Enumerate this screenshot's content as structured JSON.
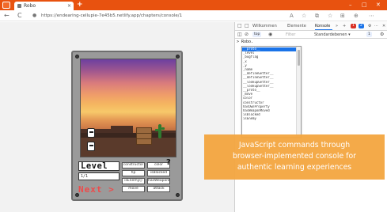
{
  "browser": {
    "tab_title": "Robo",
    "tab_close": "×",
    "new_tab": "+",
    "url": "https://endearing-cellupie-7e45b5.netlify.app/chapters/console/1",
    "window_controls": {
      "minimize": "–",
      "maximize": "□",
      "close": "✕"
    },
    "nav": {
      "back": "←",
      "reload": "C",
      "lock": "🔒"
    },
    "toolbar_icons": [
      "A",
      "☆",
      "⧉",
      "☆",
      "⊞",
      "⊕",
      "⋯"
    ],
    "accent_color": "#e8520f"
  },
  "game": {
    "level_label": "Level",
    "input_value": "1/1",
    "next_label": "Next >",
    "help_label": "?",
    "buttons": [
      "constructor",
      "color",
      "hp",
      "isBlocked",
      "isEnemy()",
      "hasWeaponMoved",
      "move",
      "attack"
    ]
  },
  "devtools": {
    "tabs": [
      "Willkommen",
      "Elemente",
      "Konsole",
      "»",
      "+"
    ],
    "active_tab": "Konsole",
    "error_count": "1",
    "warning_count": "2",
    "more": "⋯",
    "close": "✕",
    "toolbar": {
      "top_label": "top",
      "filter_placeholder": "Filter",
      "levels_label": "Standardebenen ▾",
      "issue_count": "1",
      "settings": "⚙"
    },
    "console_input": "> Robo.",
    "autocomplete": [
      "__proto__",
      "_level",
      "_bugflag",
      "_x",
      "_y",
      "_name",
      "__defineGetter__",
      "__defineSetter__",
      "__lookupGetter__",
      "__lookupSetter__",
      "__proto__",
      "_move",
      "color",
      "constructor",
      "hasOwnProperty",
      "hasWeaponMoved",
      "isBlocked",
      "isEnemy"
    ],
    "selected_index": 0
  },
  "caption": {
    "line1": "JavaScript commands through",
    "line2": "browser-implemented console for",
    "line3": "authentic learning experiences"
  }
}
